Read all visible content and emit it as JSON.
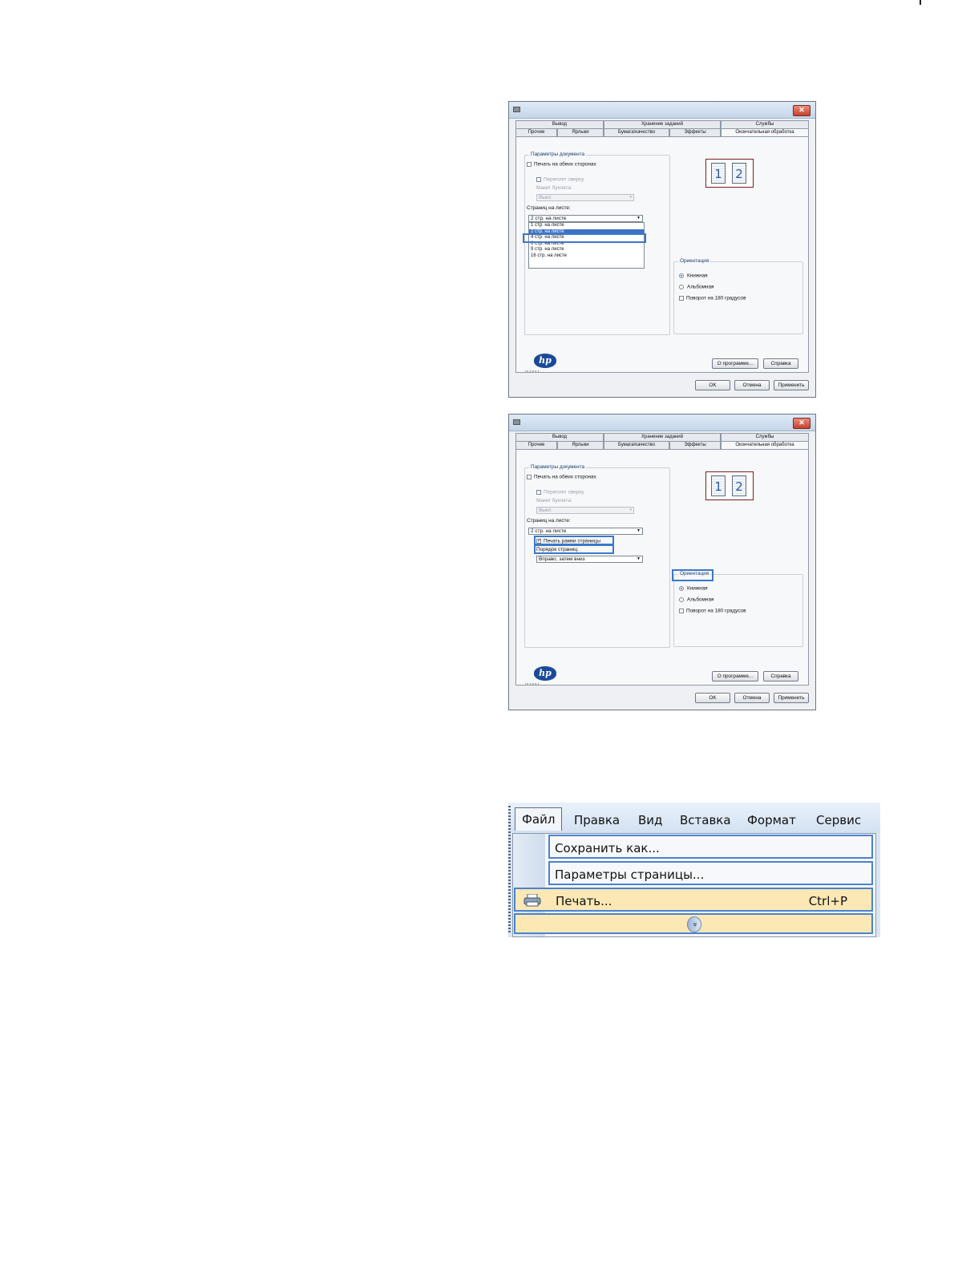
{
  "dialog1": {
    "tabs_row1": [
      "Вывод",
      "Хранение заданий",
      "Службы"
    ],
    "tabs_row2": [
      "Прочие",
      "Ярлыки",
      "Бумага/качество",
      "Эффекты",
      "Окончательная обработка"
    ],
    "doc_params_legend": "Параметры документа",
    "duplex_label": "Печать на обеих сторонах",
    "flip_label": "Переплет сверху",
    "booklet_label": "Макет буклета:",
    "booklet_value": "Выкл.",
    "pages_per_sheet_label": "Страниц на листе:",
    "pages_per_sheet_value": "2 стр. на листе",
    "pages_per_sheet_options": [
      "1 стр. на листе",
      "2 стр. на листе",
      "4 стр. на листе",
      "6 стр. на листе",
      "9 стр. на листе",
      "16 стр. на листе"
    ],
    "preview_pages": [
      "1",
      "2"
    ],
    "orientation_legend": "Ориентация",
    "portrait_label": "Книжная",
    "landscape_label": "Альбомная",
    "rotate_label": "Поворот на 180 градусов",
    "about_button": "О программе...",
    "help_button": "Справка",
    "ok_button": "OK",
    "cancel_button": "Отмена",
    "apply_button": "Применить",
    "logo_text": "hp",
    "logo_sub": "invent"
  },
  "dialog2": {
    "tabs_row1": [
      "Вывод",
      "Хранение заданий",
      "Службы"
    ],
    "tabs_row2": [
      "Прочие",
      "Ярлыки",
      "Бумага/качество",
      "Эффекты",
      "Окончательная обработка"
    ],
    "doc_params_legend": "Параметры документа",
    "duplex_label": "Печать на обеих сторонах",
    "flip_label": "Переплет сверху",
    "booklet_label": "Макет буклета:",
    "booklet_value": "Выкл.",
    "pages_per_sheet_label": "Страниц на листе:",
    "pages_per_sheet_value": "2 стр. на листе",
    "print_borders_label": "Печать рамки страницы",
    "page_order_label": "Порядок страниц:",
    "page_order_value": "Вправо, затем вниз",
    "preview_pages": [
      "1",
      "2"
    ],
    "orientation_legend": "Ориентация",
    "portrait_label": "Книжная",
    "landscape_label": "Альбомная",
    "rotate_label": "Поворот на 180 градусов",
    "about_button": "О программе...",
    "help_button": "Справка",
    "ok_button": "OK",
    "cancel_button": "Отмена",
    "apply_button": "Применить",
    "logo_text": "hp",
    "logo_sub": "invent"
  },
  "office_menu": {
    "menubar": [
      "Файл",
      "Правка",
      "Вид",
      "Вставка",
      "Формат",
      "Сервис"
    ],
    "items": [
      {
        "label": "Сохранить как...",
        "shortcut": ""
      },
      {
        "label": "Параметры страницы...",
        "shortcut": ""
      },
      {
        "label": "Печать...",
        "shortcut": "Ctrl+P"
      }
    ],
    "expand_icon": "chevron-double-down-icon"
  },
  "colors": {
    "highlight": "#3c78c8",
    "menu_hot": "#fbe8b5"
  }
}
